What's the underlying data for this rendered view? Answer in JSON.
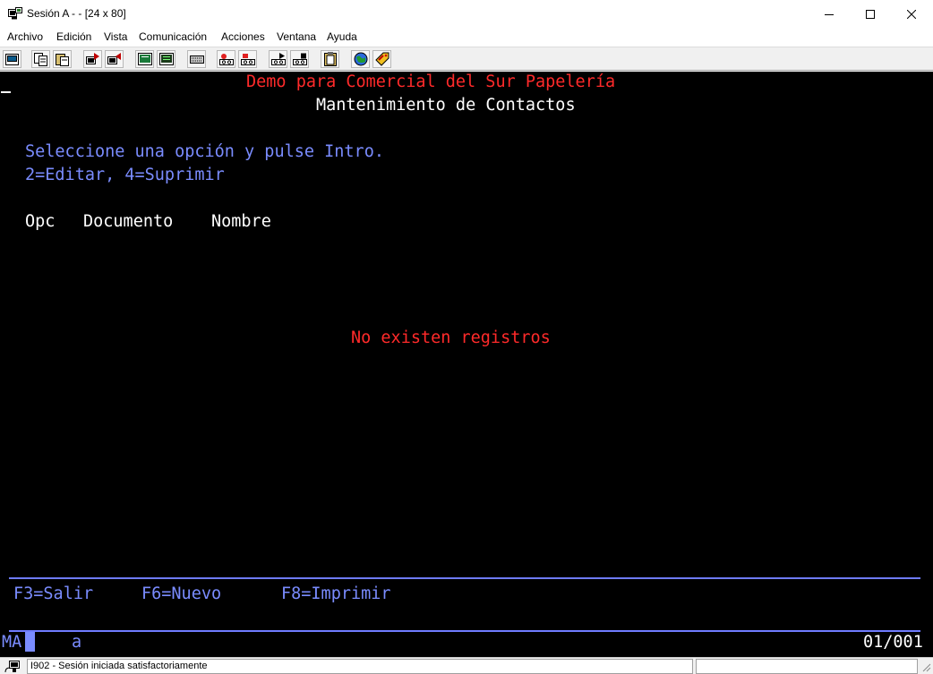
{
  "window": {
    "title": "Sesión A -  - [24 x 80]"
  },
  "menu": [
    "Archivo",
    "Edición",
    "Vista",
    "Comunicación",
    "Acciones",
    "Ventana",
    "Ayuda"
  ],
  "toolbar": {
    "icons": [
      "print-screen-icon",
      "copy-icon",
      "paste-icon",
      "send-icon",
      "receive-icon",
      "display-icon",
      "keypad-icon",
      "record-macro-icon",
      "stop-macro-icon",
      "play-macro-icon",
      "macro-icon",
      "clipboard-icon",
      "globe-icon",
      "tag-icon"
    ]
  },
  "terminal": {
    "company": "Demo para Comercial del Sur Papelería",
    "screen_title": "Mantenimiento de Contactos",
    "instruction": "Seleccione una opción y pulse Intro.",
    "options": "2=Editar, 4=Suprimir",
    "columns": {
      "opc": "Opc",
      "documento": "Documento",
      "nombre": "Nombre"
    },
    "empty_message": "No existen registros",
    "function_keys": {
      "f3": "F3=Salir",
      "f6": "F6=Nuevo",
      "f8": "F8=Imprimir"
    },
    "oia": {
      "mode": "MA",
      "input": "a",
      "position": "01/001"
    }
  },
  "statusbar": {
    "message": "I902 - Sesión iniciada satisfactoriamente"
  },
  "colors": {
    "terminal_bg": "#000000",
    "red": "#ff2a2a",
    "blue": "#7a8cff",
    "white": "#ffffff"
  }
}
